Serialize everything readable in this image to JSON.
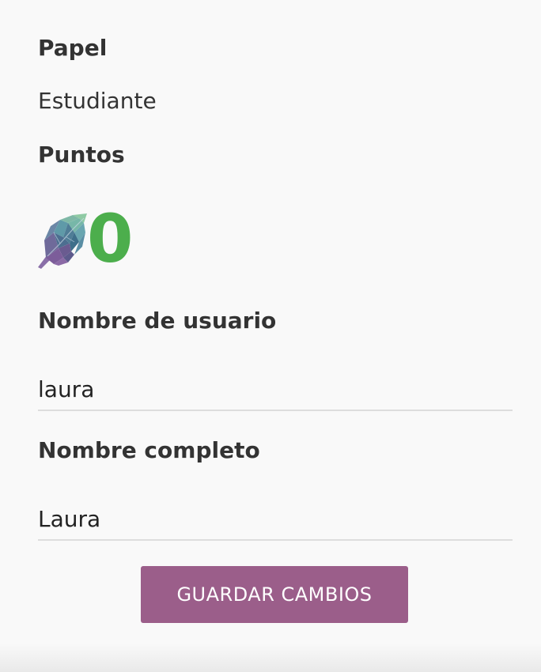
{
  "profile": {
    "role_label": "Papel",
    "role_value": "Estudiante",
    "points_label": "Puntos",
    "points_value": "0",
    "points_icon": "leaf-icon",
    "points_color": "#4cae4c"
  },
  "form": {
    "username_label": "Nombre de usuario",
    "username_value": "laura",
    "fullname_label": "Nombre completo",
    "fullname_value": "Laura",
    "save_label": "GUARDAR CAMBIOS",
    "save_color": "#9b5e8a"
  }
}
